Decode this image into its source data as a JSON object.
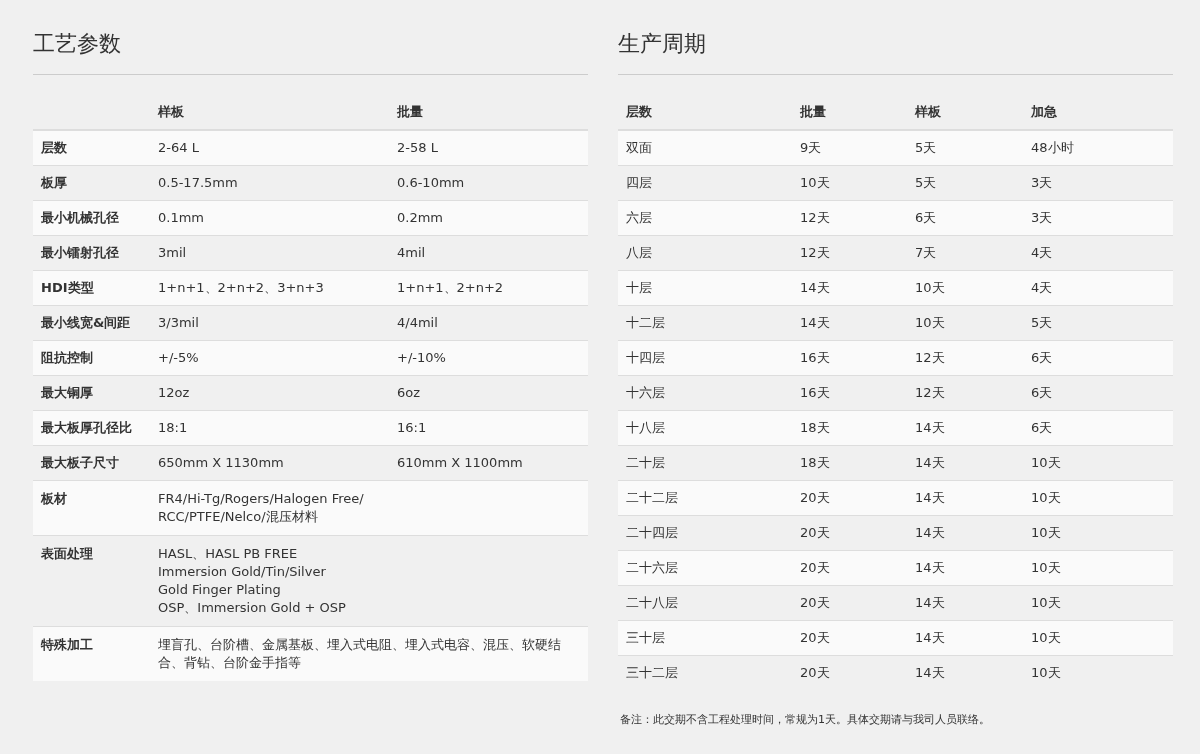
{
  "process_params": {
    "title": "工艺参数",
    "columns": [
      "样板",
      "批量"
    ],
    "rows": [
      {
        "label": "层数",
        "values": [
          "2-64 L",
          "2-58 L"
        ]
      },
      {
        "label": "板厚",
        "values": [
          "0.5-17.5mm",
          "0.6-10mm"
        ]
      },
      {
        "label": "最小机械孔径",
        "values": [
          "0.1mm",
          "0.2mm"
        ]
      },
      {
        "label": "最小镭射孔径",
        "values": [
          "3mil",
          "4mil"
        ]
      },
      {
        "label": "HDI类型",
        "values": [
          "1+n+1、2+n+2、3+n+3",
          "1+n+1、2+n+2"
        ]
      },
      {
        "label": "最小线宽&间距",
        "values": [
          "3/3mil",
          "4/4mil"
        ]
      },
      {
        "label": "阻抗控制",
        "values": [
          "+/-5%",
          "+/-10%"
        ]
      },
      {
        "label": "最大铜厚",
        "values": [
          "12oz",
          "6oz"
        ]
      },
      {
        "label": "最大板厚孔径比",
        "values": [
          "18:1",
          "16:1"
        ]
      },
      {
        "label": "最大板子尺寸",
        "values": [
          "650mm X 1130mm",
          "610mm X 1100mm"
        ]
      },
      {
        "label": "板材",
        "values": [
          "FR4/Hi-Tg/Rogers/Halogen Free/\nRCC/PTFE/Nelco/混压材料"
        ]
      },
      {
        "label": "表面处理",
        "values": [
          "HASL、HASL PB FREE\nImmersion Gold/Tin/Silver\nGold Finger Plating\nOSP、Immersion Gold + OSP"
        ]
      },
      {
        "label": "特殊加工",
        "values": [
          "埋盲孔、台阶槽、金属基板、埋入式电阻、埋入式电容、混压、软硬结合、背钻、台阶金手指等"
        ]
      }
    ]
  },
  "lead_time": {
    "title": "生产周期",
    "columns": [
      "层数",
      "批量",
      "样板",
      "加急"
    ],
    "rows": [
      [
        "双面",
        "9天",
        "5天",
        "48小时"
      ],
      [
        "四层",
        "10天",
        "5天",
        "3天"
      ],
      [
        "六层",
        "12天",
        "6天",
        "3天"
      ],
      [
        "八层",
        "12天",
        "7天",
        "4天"
      ],
      [
        "十层",
        "14天",
        "10天",
        "4天"
      ],
      [
        "十二层",
        "14天",
        "10天",
        "5天"
      ],
      [
        "十四层",
        "16天",
        "12天",
        "6天"
      ],
      [
        "十六层",
        "16天",
        "12天",
        "6天"
      ],
      [
        "十八层",
        "18天",
        "14天",
        "6天"
      ],
      [
        "二十层",
        "18天",
        "14天",
        "10天"
      ],
      [
        "二十二层",
        "20天",
        "14天",
        "10天"
      ],
      [
        "二十四层",
        "20天",
        "14天",
        "10天"
      ],
      [
        "二十六层",
        "20天",
        "14天",
        "10天"
      ],
      [
        "二十八层",
        "20天",
        "14天",
        "10天"
      ],
      [
        "三十层",
        "20天",
        "14天",
        "10天"
      ],
      [
        "三十二层",
        "20天",
        "14天",
        "10天"
      ]
    ],
    "note": "备注：此交期不含工程处理时间，常规为1天。具体交期请与我司人员联络。"
  }
}
